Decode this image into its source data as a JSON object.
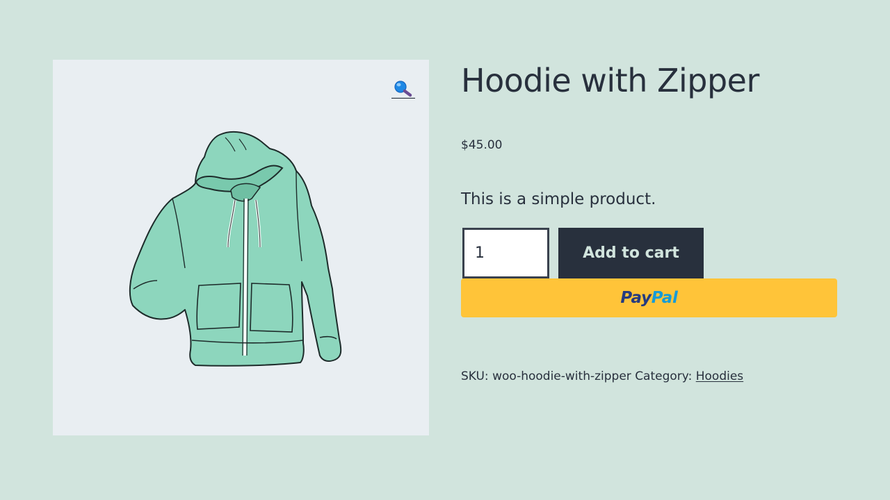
{
  "product": {
    "title": "Hoodie with Zipper",
    "price": "$45.00",
    "short_description": "This is a simple product.",
    "quantity": "1",
    "add_to_cart_label": "Add to cart",
    "paypal_label_part1": "Pay",
    "paypal_label_part2": "Pal",
    "sku_label": "SKU:",
    "sku_value": "woo-hoodie-with-zipper",
    "category_label": "Category:",
    "category_link": "Hoodies"
  },
  "gallery": {
    "zoom_icon": "magnifier-zoom-icon",
    "image": "hoodie-with-zipper-illustration"
  },
  "colors": {
    "page_background": "#d1e4dd",
    "gallery_background": "#e9eef2",
    "text": "#28303d",
    "button_background": "#28303d",
    "button_text": "#d1e4dd",
    "paypal_yellow": "#ffc439",
    "paypal_dark_blue": "#253b80",
    "paypal_light_blue": "#179bd7",
    "hoodie_fill": "#8dd6bd"
  }
}
